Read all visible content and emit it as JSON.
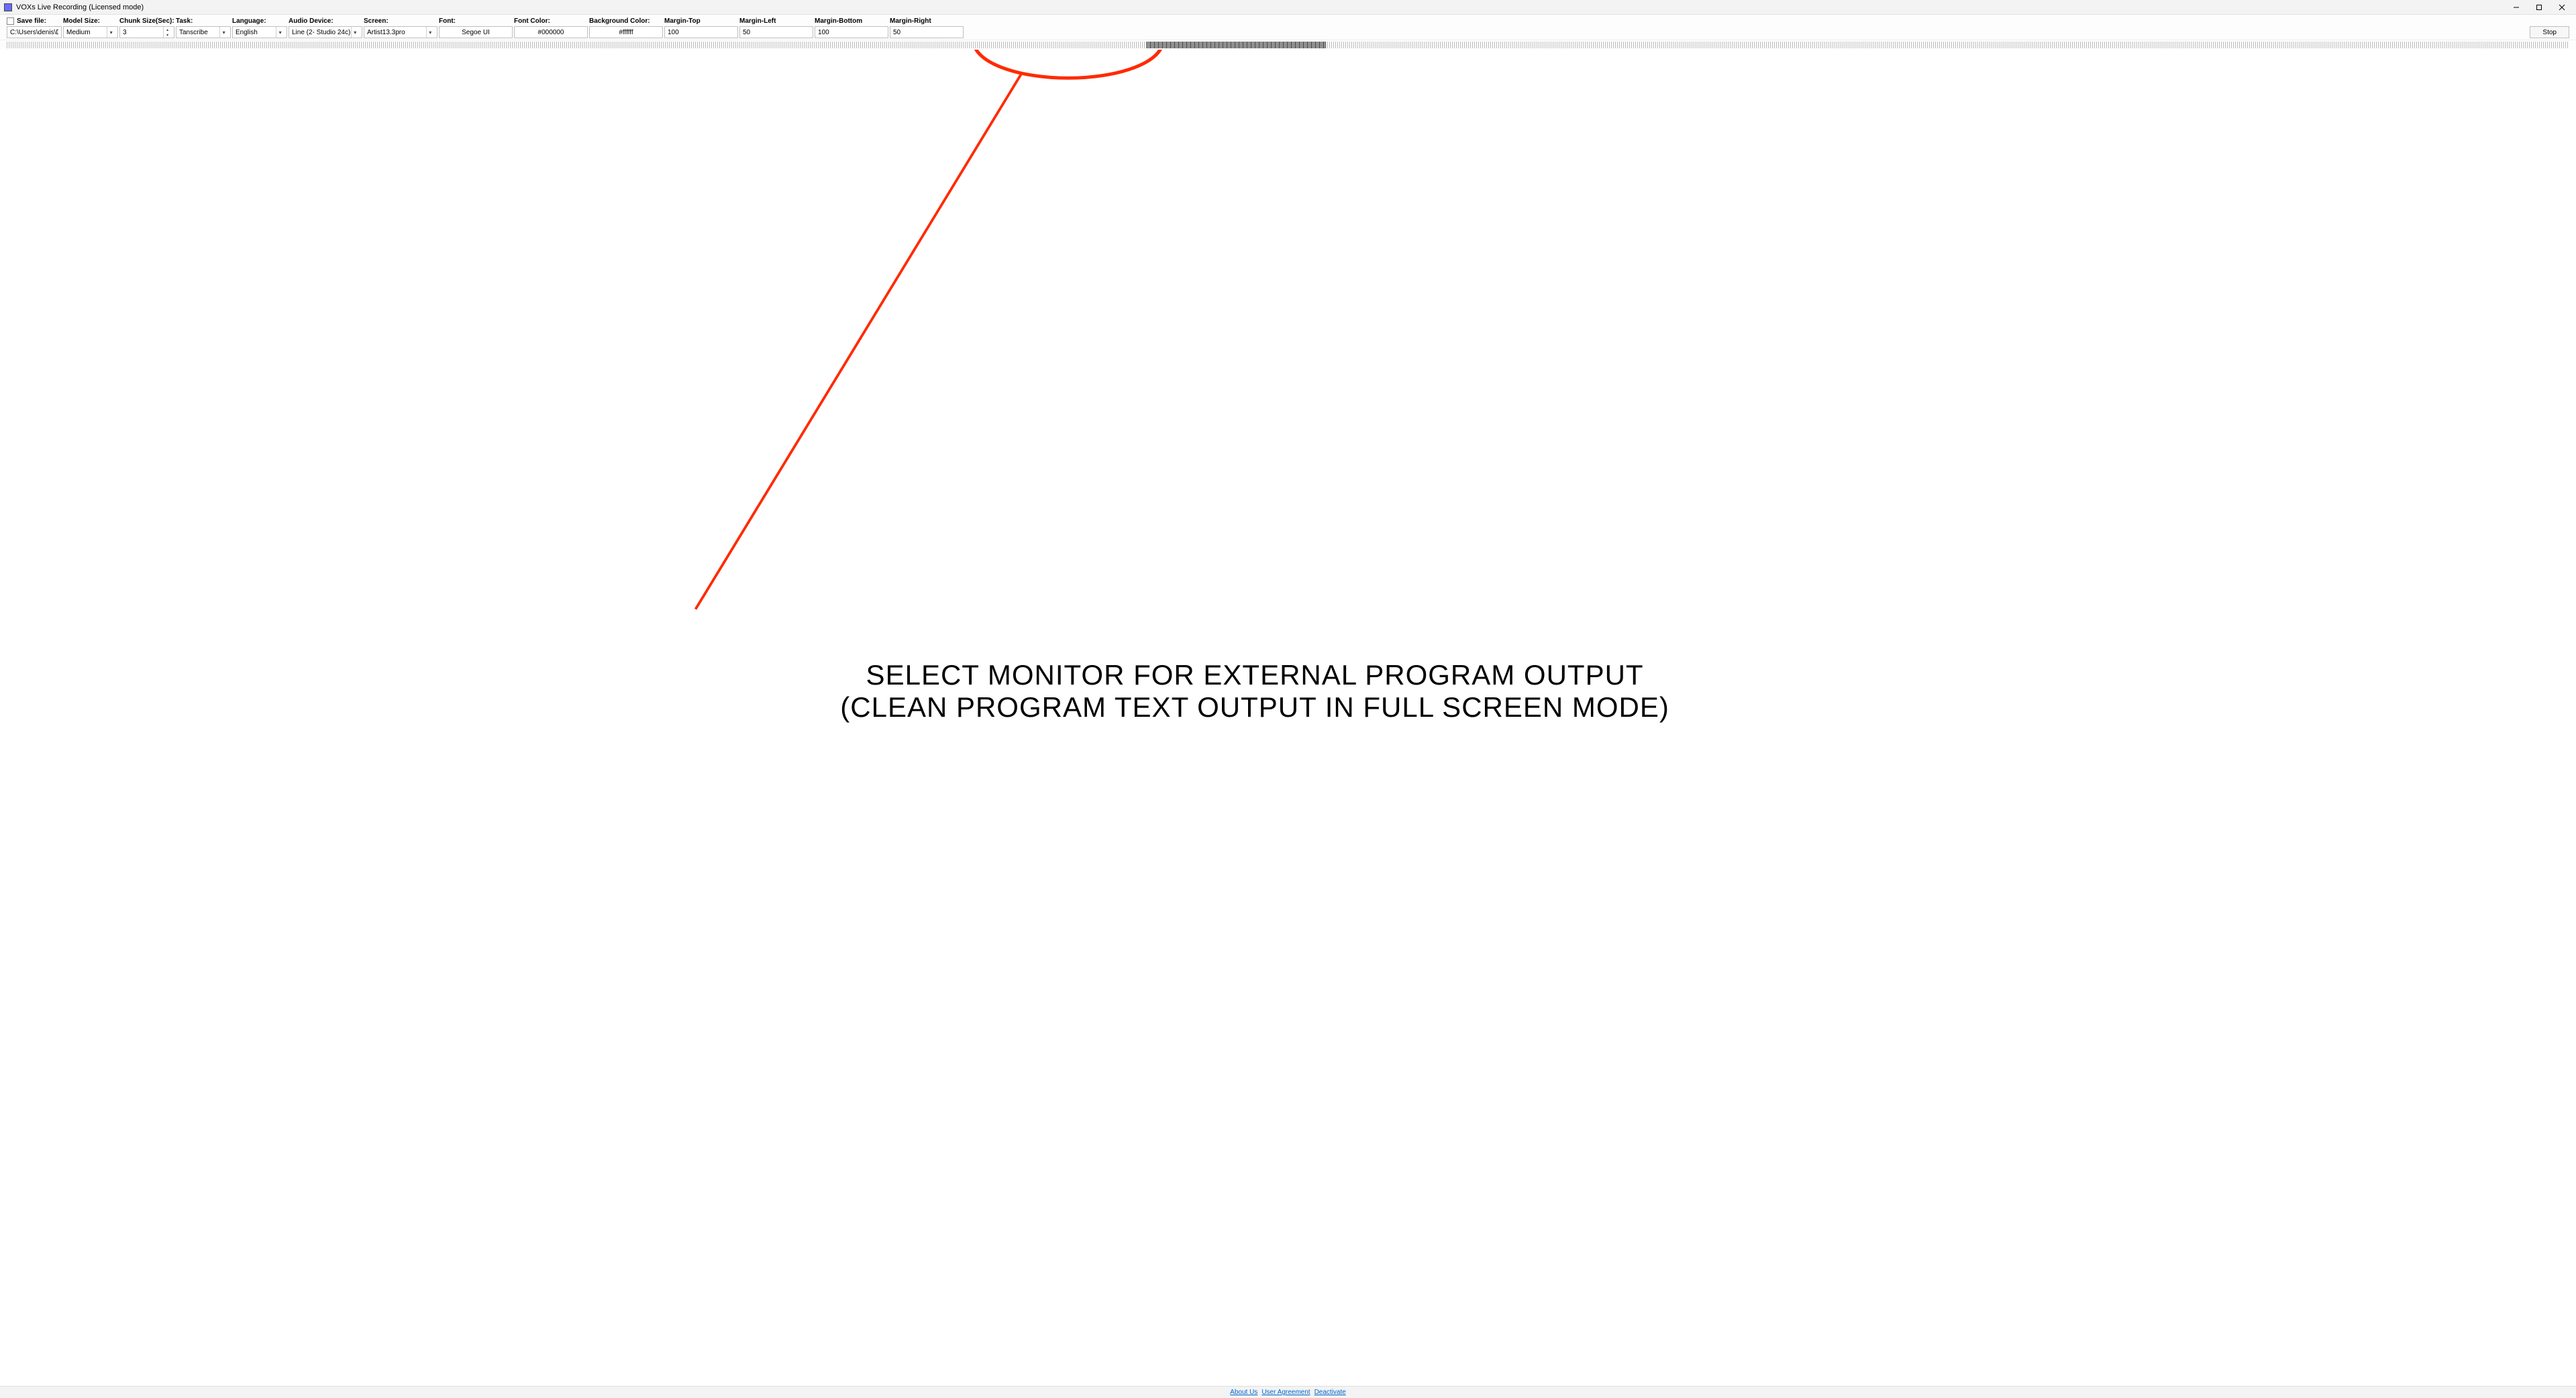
{
  "titlebar": {
    "title": "VOXs Live Recording (Licensed mode)"
  },
  "toolbar": {
    "save_file": {
      "label": "Save file:",
      "value": "C:\\Users\\denis\\Desktop"
    },
    "model_size": {
      "label": "Model Size:",
      "value": "Medium"
    },
    "chunk": {
      "label": "Chunk Size(Sec):",
      "value": "3"
    },
    "task": {
      "label": "Task:",
      "value": "Tanscribe"
    },
    "language": {
      "label": "Language:",
      "value": "English"
    },
    "audio": {
      "label": "Audio Device:",
      "value": "Line (2- Studio 24c)"
    },
    "screen": {
      "label": "Screen:",
      "value": "Artist13.3pro"
    },
    "font": {
      "label": "Font:",
      "value": "Segoe UI"
    },
    "font_color": {
      "label": "Font Color:",
      "value": "#000000"
    },
    "bg_color": {
      "label": "Background Color:",
      "value": "#ffffff"
    },
    "margin_top": {
      "label": "Margin-Top",
      "value": "100"
    },
    "margin_left": {
      "label": "Margin-Left",
      "value": "50"
    },
    "margin_bot": {
      "label": "Margin-Bottom",
      "value": "100"
    },
    "margin_right": {
      "label": "Margin-Right",
      "value": "50"
    },
    "stop": "Stop"
  },
  "annotation": {
    "line1": "SELECT MONITOR FOR EXTERNAL PROGRAM OUTPUT",
    "line2": "(CLEAN PROGRAM TEXT OUTPUT IN FULL SCREEN MODE)"
  },
  "footer": {
    "about": "About Us",
    "agreement": "User Agreement",
    "deactivate": "Deactivate"
  }
}
